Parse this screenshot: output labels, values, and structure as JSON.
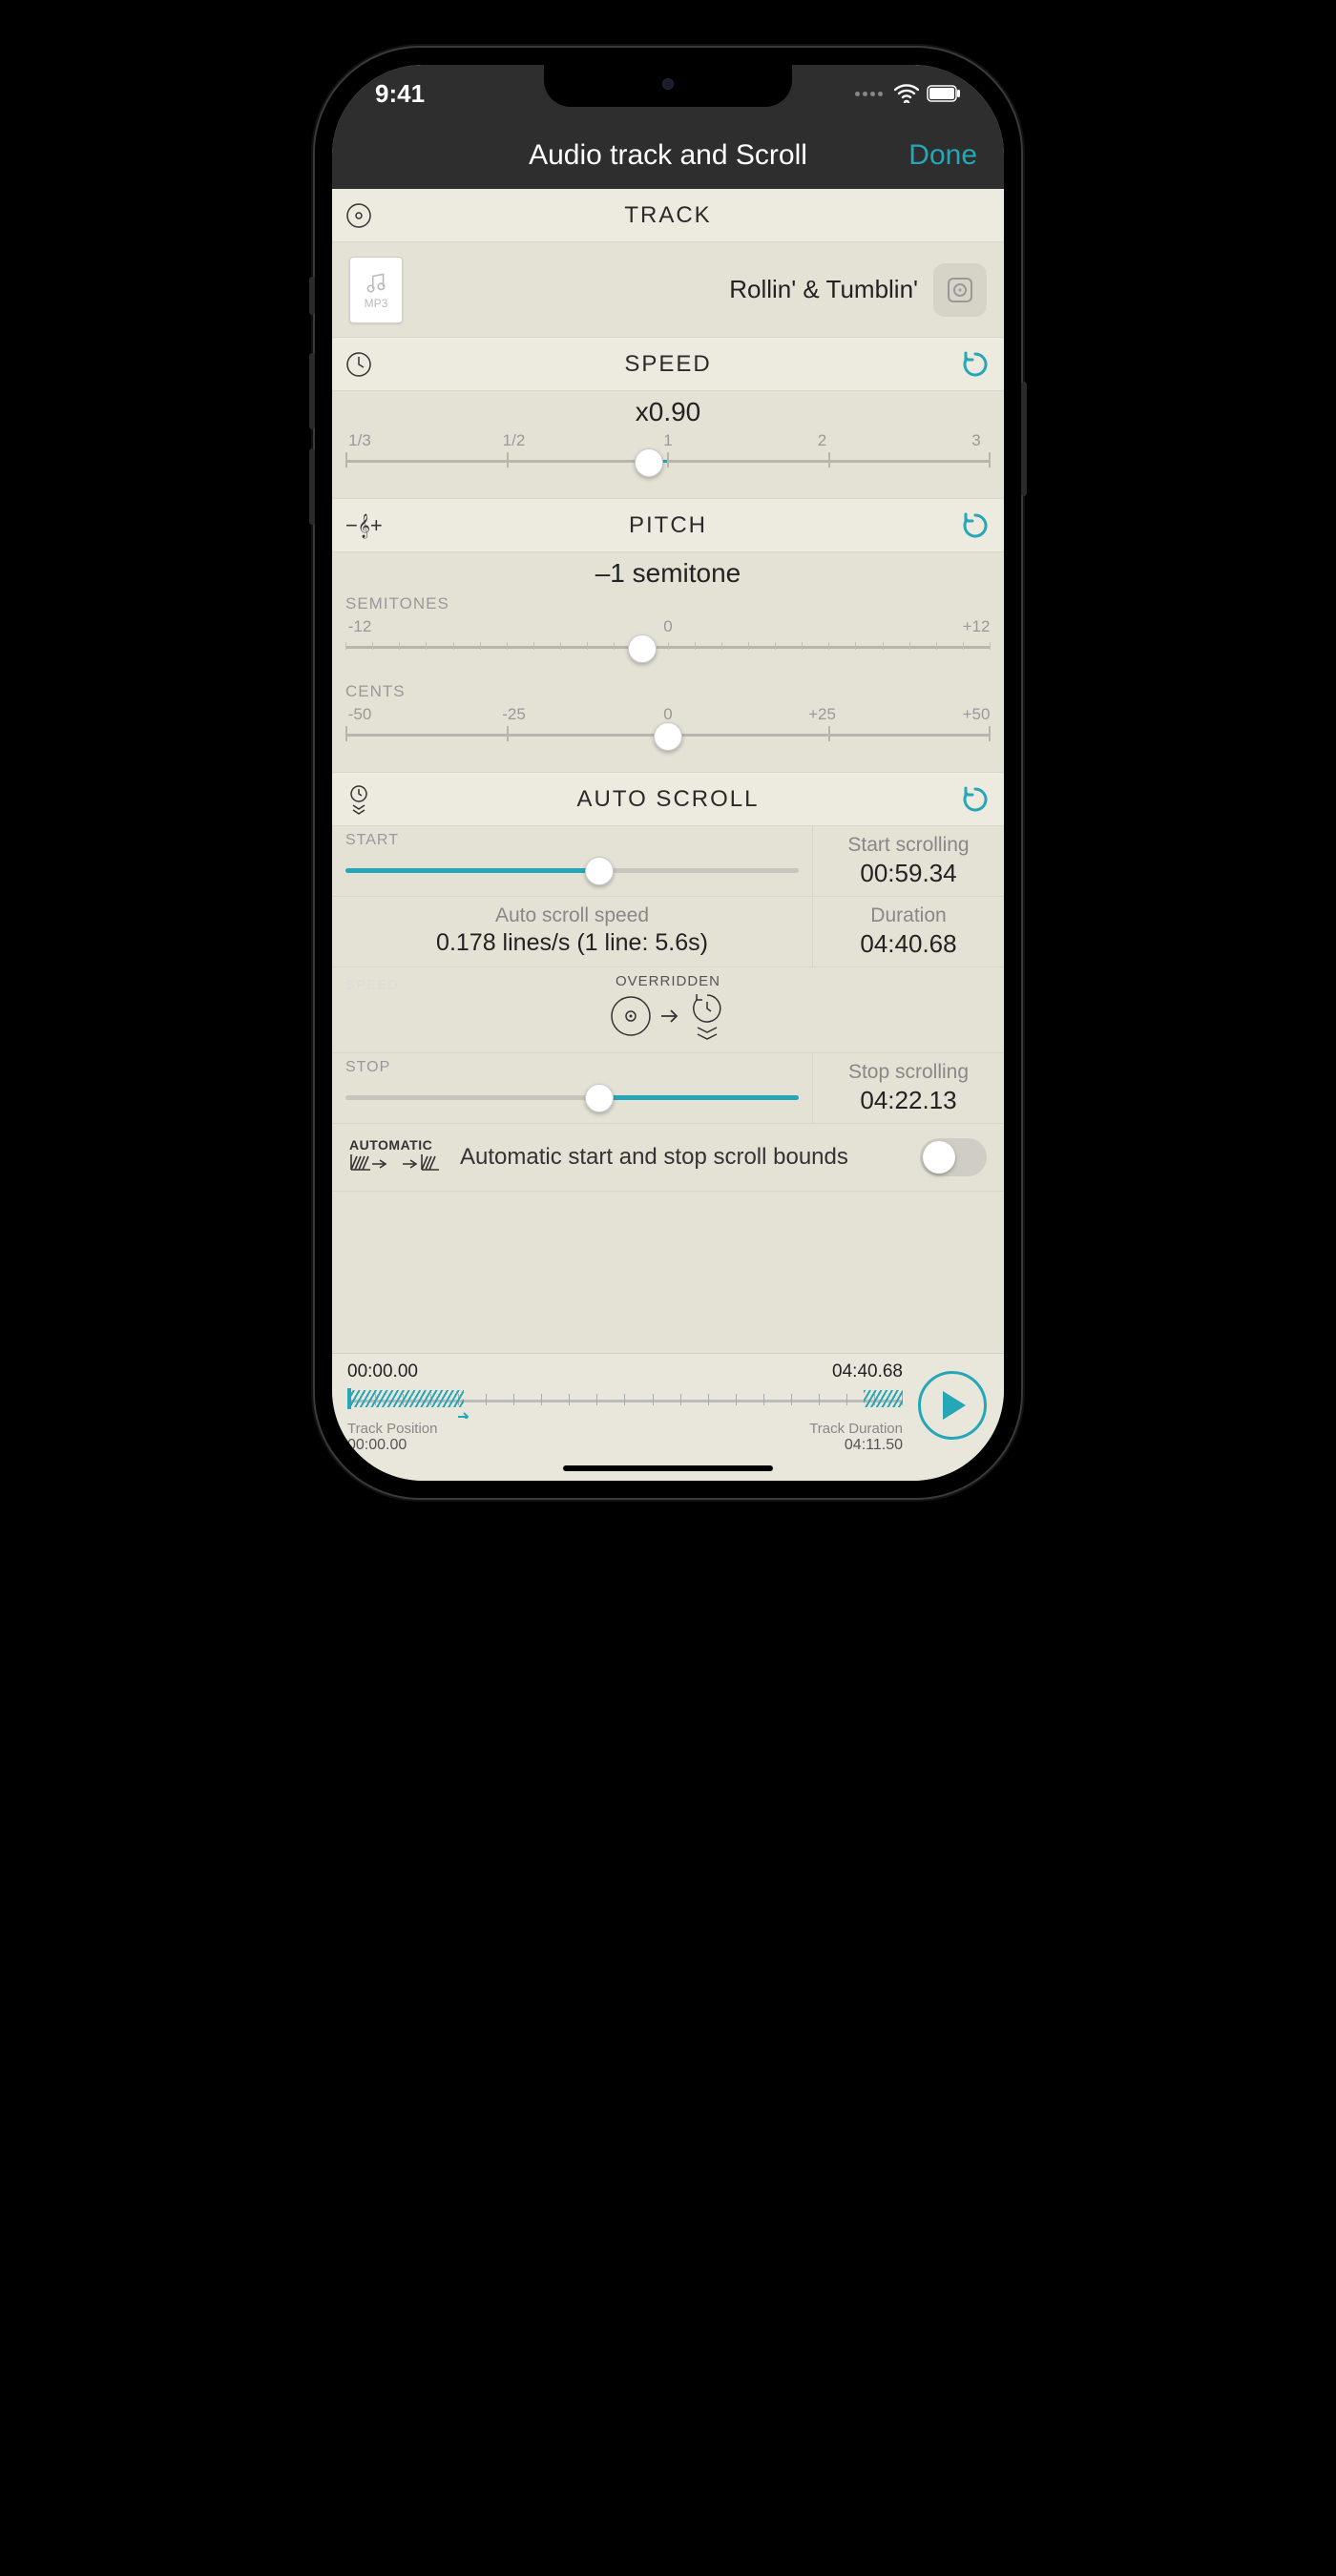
{
  "status": {
    "time": "9:41"
  },
  "nav": {
    "title": "Audio track and Scroll",
    "done": "Done"
  },
  "track": {
    "header": "TRACK",
    "badge": "MP3",
    "name": "Rollin' & Tumblin'"
  },
  "speed": {
    "header": "SPEED",
    "value": "x0.90",
    "ticks": [
      "1/3",
      "1/2",
      "1",
      "2",
      "3"
    ],
    "thumb_pct": 47,
    "fill_from_pct": 47,
    "fill_to_pct": 50
  },
  "pitch": {
    "header": "PITCH",
    "value": "–1 semitone",
    "semitones_label": "SEMITONES",
    "semitones_ticks": [
      "-12",
      "0",
      "+12"
    ],
    "semitones_thumb_pct": 46,
    "cents_label": "CENTS",
    "cents_ticks": [
      "-50",
      "-25",
      "0",
      "+25",
      "+50"
    ],
    "cents_thumb_pct": 50
  },
  "autoscroll": {
    "header": "AUTO SCROLL",
    "start_label": "START",
    "start_thumb_pct": 56,
    "start_scrolling_label": "Start scrolling",
    "start_scrolling_value": "00:59.34",
    "speed_label": "Auto scroll speed",
    "speed_value": "0.178 lines/s (1 line: 5.6s)",
    "duration_label": "Duration",
    "duration_value": "04:40.68",
    "overridden_label": "OVERRIDDEN",
    "faint_label": "SPEED",
    "stop_label": "STOP",
    "stop_thumb_pct": 56,
    "stop_scrolling_label": "Stop scrolling",
    "stop_scrolling_value": "04:22.13",
    "auto_bounds_badge": "AUTOMATIC",
    "auto_bounds_text": "Automatic start and stop scroll bounds",
    "auto_bounds_on": false
  },
  "footer": {
    "left_time": "00:00.00",
    "right_time": "04:40.68",
    "track_position_label": "Track Position",
    "track_duration_label": "Track Duration",
    "track_position_value": "00:00.00",
    "track_duration_value": "04:11.50",
    "hatch_a_left_pct": 0,
    "hatch_a_width_pct": 21,
    "hatch_b_left_pct": 93,
    "hatch_b_width_pct": 7,
    "marker_pct": 21
  }
}
